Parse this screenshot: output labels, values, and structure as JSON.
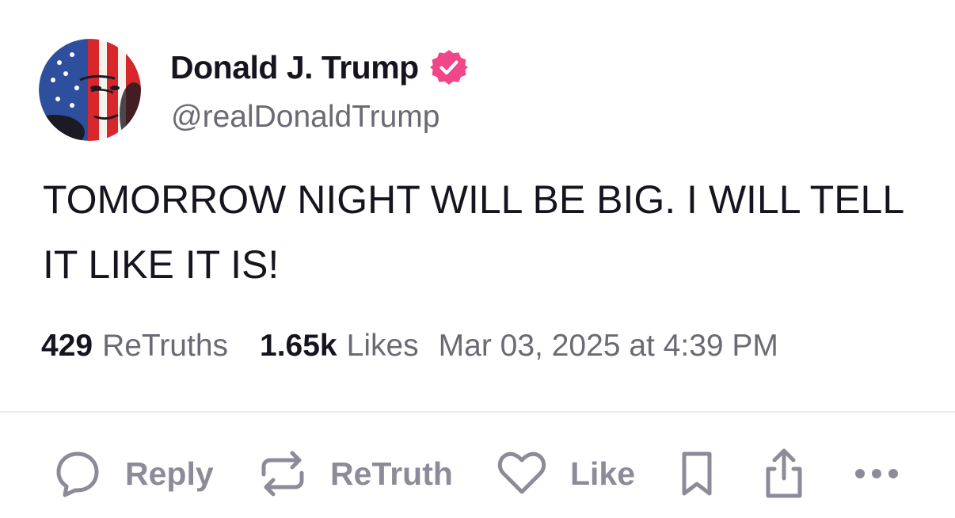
{
  "post": {
    "author": {
      "display_name": "Donald J. Trump",
      "handle": "@realDonaldTrump",
      "verified": true
    },
    "text": "TOMORROW NIGHT WILL BE BIG. I WILL TELL IT LIKE IT IS!",
    "stats": {
      "retruths_count": "429",
      "retruths_label": "ReTruths",
      "likes_count": "1.65k",
      "likes_label": "Likes",
      "timestamp": "Mar 03, 2025 at 4:39 PM"
    }
  },
  "actions": {
    "reply_label": "Reply",
    "retruth_label": "ReTruth",
    "like_label": "Like"
  },
  "icons": {
    "verified": "verified-badge-icon",
    "reply": "speech-bubble-icon",
    "retruth": "repost-arrows-icon",
    "like": "heart-icon",
    "bookmark": "bookmark-icon",
    "share": "share-icon",
    "more": "more-dots-icon"
  },
  "colors": {
    "verified_badge": "#f0478a",
    "text_primary": "#17141f",
    "text_secondary": "#6b6a74",
    "action_gray": "#8e8b98"
  }
}
